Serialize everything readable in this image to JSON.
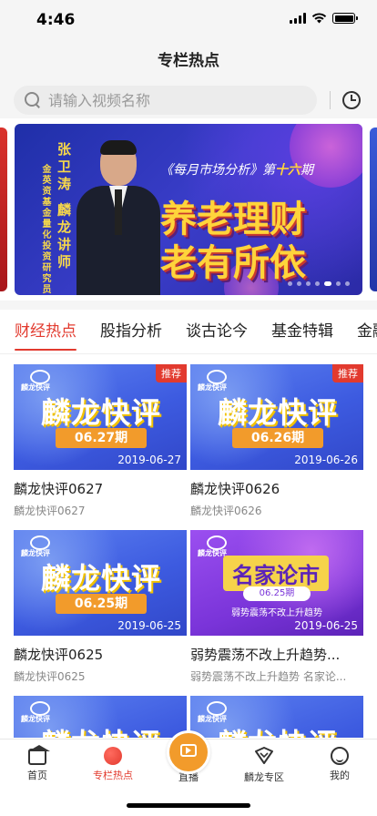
{
  "status_bar": {
    "time": "4:46"
  },
  "nav": {
    "title": "专栏热点"
  },
  "search": {
    "placeholder": "请输入视频名称"
  },
  "banner": {
    "host_name": "张卫涛 麟龙讲师",
    "host_role": "金英资基金量化投资研究员",
    "subtitle_pre": "《每月市场分析》第",
    "subtitle_num": "十六",
    "subtitle_post": "期",
    "headline_line1": "养老理财",
    "headline_line2": "老有所依",
    "dots_total": 7,
    "dots_active": 5
  },
  "tabs": [
    {
      "label": "财经热点",
      "active": true
    },
    {
      "label": "股指分析",
      "active": false
    },
    {
      "label": "谈古论今",
      "active": false
    },
    {
      "label": "基金特辑",
      "active": false
    },
    {
      "label": "金融",
      "active": false
    }
  ],
  "videos": [
    {
      "style": "blue",
      "logo": "麟龙快评",
      "tag": "推荐",
      "thumb_title": "麟龙快评",
      "issue": "06.27期",
      "date": "2019-06-27",
      "title": "麟龙快评0627",
      "subtitle": "麟龙快评0627"
    },
    {
      "style": "blue",
      "logo": "麟龙快评",
      "tag": "推荐",
      "thumb_title": "麟龙快评",
      "issue": "06.26期",
      "date": "2019-06-26",
      "title": "麟龙快评0626",
      "subtitle": "麟龙快评0626"
    },
    {
      "style": "blue",
      "logo": "麟龙快评",
      "tag": "",
      "thumb_title": "麟龙快评",
      "issue": "06.25期",
      "date": "2019-06-25",
      "title": "麟龙快评0625",
      "subtitle": "麟龙快评0625"
    },
    {
      "style": "purple",
      "logo": "麟龙快评",
      "tag": "",
      "thumb_title": "名家论市",
      "issue": "06.25期",
      "thumb_sub": "弱势震荡不改上升趋势",
      "date": "2019-06-25",
      "title": "弱势震荡不改上升趋势...",
      "subtitle": "弱势震荡不改上升趋势 名家论..."
    },
    {
      "style": "blue",
      "logo": "麟龙快评",
      "tag": "",
      "thumb_title": "麟龙快评",
      "issue": "",
      "date": "",
      "title": "",
      "subtitle": ""
    },
    {
      "style": "blue",
      "logo": "麟龙快评",
      "tag": "",
      "thumb_title": "麟龙快评",
      "issue": "",
      "date": "",
      "title": "",
      "subtitle": ""
    }
  ],
  "tabbar": [
    {
      "label": "首页",
      "icon": "home-icon",
      "active": false
    },
    {
      "label": "专栏热点",
      "icon": "hot-icon",
      "active": true
    },
    {
      "label": "直播",
      "icon": "live-icon",
      "active": false
    },
    {
      "label": "麟龙专区",
      "icon": "zone-icon",
      "active": false
    },
    {
      "label": "我的",
      "icon": "profile-icon",
      "active": false
    }
  ],
  "colors": {
    "accent": "#e23a2e",
    "live": "#f29b2b",
    "background": "#f5f5f5"
  }
}
